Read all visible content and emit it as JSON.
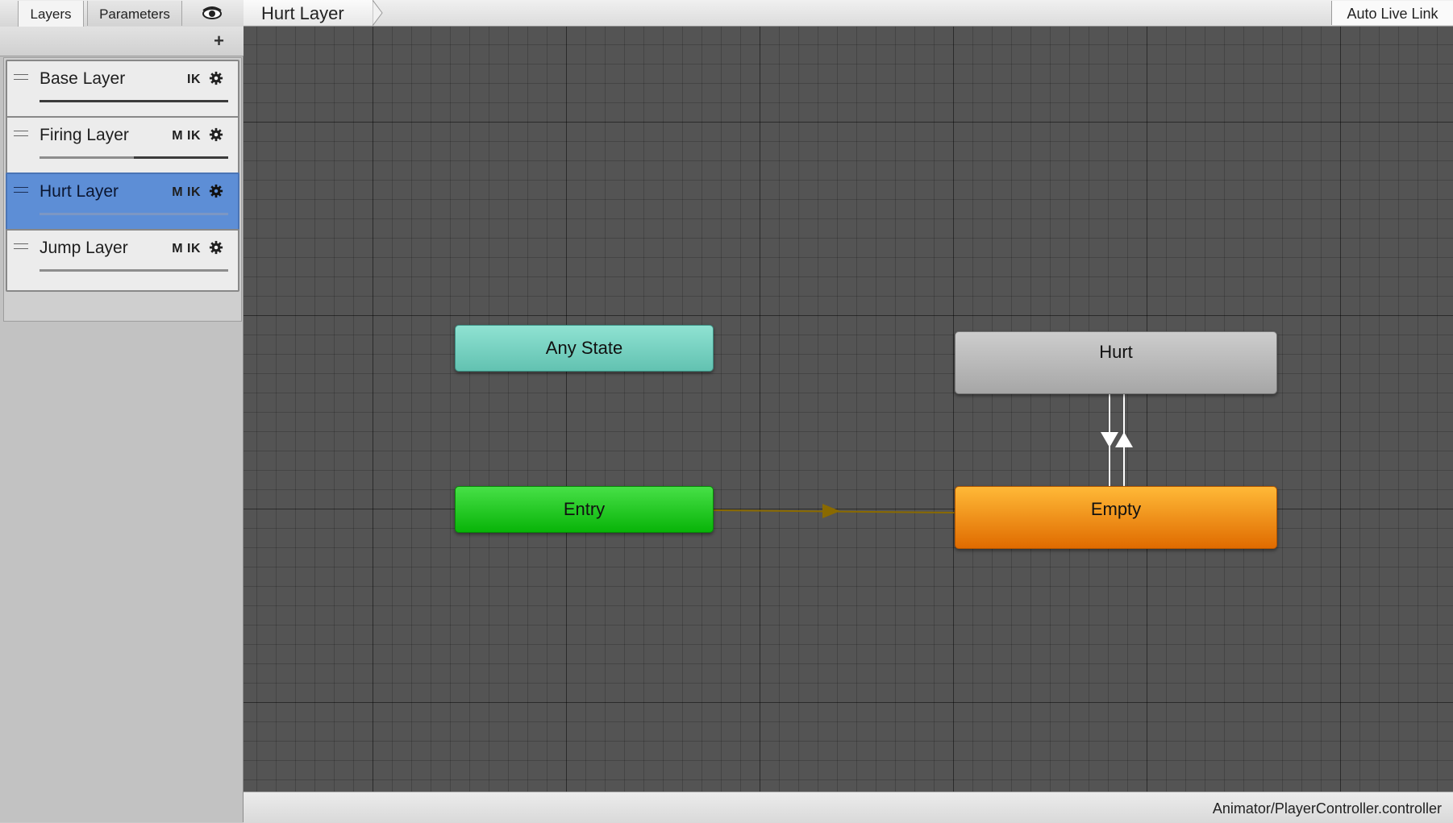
{
  "panel": {
    "tabs": [
      "Layers",
      "Parameters"
    ],
    "eye_icon": "eye-icon",
    "add_icon": "+"
  },
  "layers": [
    {
      "name": "Base Layer",
      "flags": "IK",
      "weight": 1.0,
      "selected": false
    },
    {
      "name": "Firing Layer",
      "flags": "M IK",
      "weight": 0.5,
      "selected": false
    },
    {
      "name": "Hurt Layer",
      "flags": "M IK",
      "weight": 0.0,
      "selected": true
    },
    {
      "name": "Jump Layer",
      "flags": "M IK",
      "weight": 0.0,
      "selected": false
    }
  ],
  "toolbar": {
    "breadcrumb": "Hurt Layer",
    "live_link": "Auto Live Link"
  },
  "graph": {
    "states": {
      "any_state": "Any State",
      "entry": "Entry",
      "hurt": "Hurt",
      "empty": "Empty"
    },
    "colors": {
      "any_state": "#7dd6c6",
      "entry": "#16c516",
      "default_state": "#f59a1c",
      "state": "#b9b9b9",
      "selected_layer": "#5d8ed6",
      "entry_transition": "#8a6a00"
    },
    "transitions": [
      {
        "from": "Entry",
        "to": "Empty",
        "type": "default"
      },
      {
        "from": "Hurt",
        "to": "Empty"
      },
      {
        "from": "Empty",
        "to": "Hurt"
      }
    ]
  },
  "status": {
    "path": "Animator/PlayerController.controller"
  }
}
